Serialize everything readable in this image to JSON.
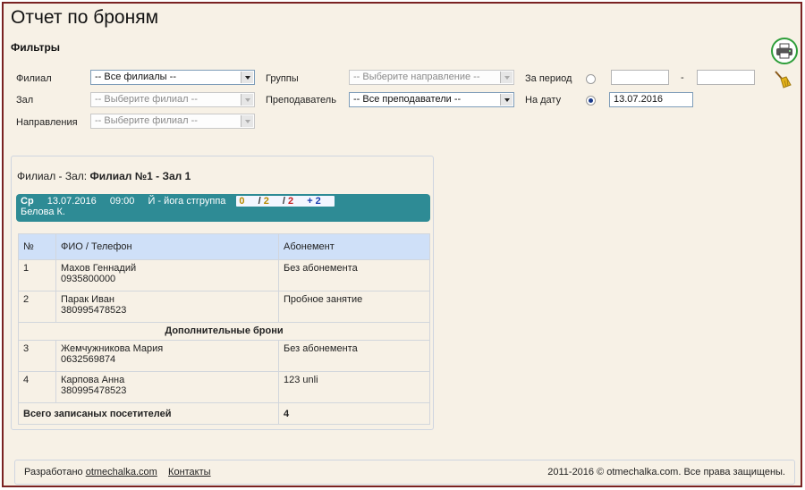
{
  "page": {
    "title": "Отчет по броням"
  },
  "filters": {
    "title": "Фильтры",
    "branch_label": "Филиал",
    "branch_value": "-- Все филиалы --",
    "hall_label": "Зал",
    "hall_value": "-- Выберите филиал --",
    "direction_label": "Направления",
    "direction_value": "-- Выберите филиал --",
    "groups_label": "Группы",
    "groups_value": "-- Выберите направление --",
    "teacher_label": "Преподаватель",
    "teacher_value": "-- Все преподаватели --",
    "period_label": "За период",
    "period_from": "",
    "period_to": "",
    "period_dash": "-",
    "date_label": "На дату",
    "date_value": "13.07.2016",
    "mode_selected": "date"
  },
  "report": {
    "branch_prefix": "Филиал - Зал:",
    "branch_name": "Филиал №1 - Зал 1",
    "session": {
      "day": "Ср",
      "date": "13.07.2016",
      "time": "09:00",
      "group": "Й - йога стгруппа",
      "count_a": "0",
      "count_b": "2",
      "count_c": "2",
      "count_d": "+ 2",
      "teacher": "Белова К."
    },
    "columns": [
      "№",
      "ФИО / Телефон",
      "Абонемент"
    ],
    "rows": [
      {
        "num": "1",
        "name": "Махов Геннадий",
        "phone": "0935800000",
        "sub": "Без абонемента"
      },
      {
        "num": "2",
        "name": "Парак Иван",
        "phone": "380995478523",
        "sub": "Пробное занятие"
      }
    ],
    "extra_title": "Дополнительные брони",
    "extra_rows": [
      {
        "num": "3",
        "name": "Жемчужникова Мария",
        "phone": "0632569874",
        "sub": "Без абонемента"
      },
      {
        "num": "4",
        "name": "Карпова Анна",
        "phone": "380995478523",
        "sub": "123 unli"
      }
    ],
    "total_label": "Всего записаных посетителей",
    "total_value": "4"
  },
  "footer": {
    "developed_by": "Разработано",
    "dev_link": "otmechalka.com",
    "contacts": "Контакты",
    "copyright": "2011-2016 © otmechalka.com. Все права защищены."
  },
  "colors": {
    "session_bg": "#2e8b95",
    "header_bg": "#cfe0f8",
    "frame": "#7a2222",
    "print_ring": "#2e9e3a"
  },
  "icons": {
    "print": "printer-icon",
    "clear": "broom-icon"
  }
}
